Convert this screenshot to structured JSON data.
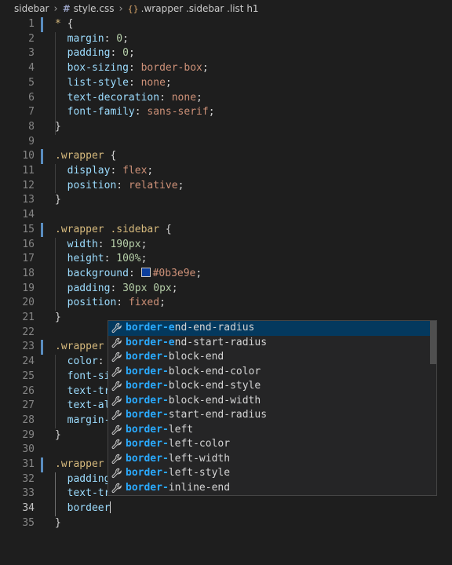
{
  "breadcrumb": {
    "folder": "sidebar",
    "file": "style.css",
    "symbol": ".wrapper .sidebar .list h1"
  },
  "editor": {
    "active_line": "34",
    "lines": [
      {
        "n": "1",
        "mod": true,
        "tokens": [
          [
            "sel",
            "* "
          ],
          [
            "punc",
            "{"
          ]
        ]
      },
      {
        "n": "2",
        "mod": false,
        "tokens": [
          [
            "punc",
            "  "
          ],
          [
            "prop",
            "margin"
          ],
          [
            "punc",
            ": "
          ],
          [
            "num",
            "0"
          ],
          [
            "punc",
            ";"
          ]
        ]
      },
      {
        "n": "3",
        "mod": false,
        "tokens": [
          [
            "punc",
            "  "
          ],
          [
            "prop",
            "padding"
          ],
          [
            "punc",
            ": "
          ],
          [
            "num",
            "0"
          ],
          [
            "punc",
            ";"
          ]
        ]
      },
      {
        "n": "4",
        "mod": false,
        "tokens": [
          [
            "punc",
            "  "
          ],
          [
            "prop",
            "box-sizing"
          ],
          [
            "punc",
            ": "
          ],
          [
            "val",
            "border-box"
          ],
          [
            "punc",
            ";"
          ]
        ]
      },
      {
        "n": "5",
        "mod": false,
        "tokens": [
          [
            "punc",
            "  "
          ],
          [
            "prop",
            "list-style"
          ],
          [
            "punc",
            ": "
          ],
          [
            "val",
            "none"
          ],
          [
            "punc",
            ";"
          ]
        ]
      },
      {
        "n": "6",
        "mod": false,
        "tokens": [
          [
            "punc",
            "  "
          ],
          [
            "prop",
            "text-decoration"
          ],
          [
            "punc",
            ": "
          ],
          [
            "val",
            "none"
          ],
          [
            "punc",
            ";"
          ]
        ]
      },
      {
        "n": "7",
        "mod": false,
        "tokens": [
          [
            "punc",
            "  "
          ],
          [
            "prop",
            "font-family"
          ],
          [
            "punc",
            ": "
          ],
          [
            "val",
            "sans-serif"
          ],
          [
            "punc",
            ";"
          ]
        ]
      },
      {
        "n": "8",
        "mod": false,
        "tokens": [
          [
            "punc",
            "}"
          ]
        ]
      },
      {
        "n": "9",
        "mod": false,
        "tokens": []
      },
      {
        "n": "10",
        "mod": true,
        "tokens": [
          [
            "sel",
            ".wrapper "
          ],
          [
            "punc",
            "{"
          ]
        ]
      },
      {
        "n": "11",
        "mod": false,
        "tokens": [
          [
            "punc",
            "  "
          ],
          [
            "prop",
            "display"
          ],
          [
            "punc",
            ": "
          ],
          [
            "val",
            "flex"
          ],
          [
            "punc",
            ";"
          ]
        ]
      },
      {
        "n": "12",
        "mod": false,
        "tokens": [
          [
            "punc",
            "  "
          ],
          [
            "prop",
            "position"
          ],
          [
            "punc",
            ": "
          ],
          [
            "val",
            "relative"
          ],
          [
            "punc",
            ";"
          ]
        ]
      },
      {
        "n": "13",
        "mod": false,
        "tokens": [
          [
            "punc",
            "}"
          ]
        ]
      },
      {
        "n": "14",
        "mod": false,
        "tokens": []
      },
      {
        "n": "15",
        "mod": true,
        "tokens": [
          [
            "sel",
            ".wrapper .sidebar "
          ],
          [
            "punc",
            "{"
          ]
        ]
      },
      {
        "n": "16",
        "mod": false,
        "tokens": [
          [
            "punc",
            "  "
          ],
          [
            "prop",
            "width"
          ],
          [
            "punc",
            ": "
          ],
          [
            "num",
            "190px"
          ],
          [
            "punc",
            ";"
          ]
        ]
      },
      {
        "n": "17",
        "mod": false,
        "tokens": [
          [
            "punc",
            "  "
          ],
          [
            "prop",
            "height"
          ],
          [
            "punc",
            ": "
          ],
          [
            "num",
            "100%"
          ],
          [
            "punc",
            ";"
          ]
        ]
      },
      {
        "n": "18",
        "mod": false,
        "tokens": [
          [
            "punc",
            "  "
          ],
          [
            "prop",
            "background"
          ],
          [
            "punc",
            ": "
          ],
          [
            "swatch",
            ""
          ],
          [
            "val",
            "#0b3e9e"
          ],
          [
            "punc",
            ";"
          ]
        ]
      },
      {
        "n": "19",
        "mod": false,
        "tokens": [
          [
            "punc",
            "  "
          ],
          [
            "prop",
            "padding"
          ],
          [
            "punc",
            ": "
          ],
          [
            "num",
            "30px 0px"
          ],
          [
            "punc",
            ";"
          ]
        ]
      },
      {
        "n": "20",
        "mod": false,
        "tokens": [
          [
            "punc",
            "  "
          ],
          [
            "prop",
            "position"
          ],
          [
            "punc",
            ": "
          ],
          [
            "val",
            "fixed"
          ],
          [
            "punc",
            ";"
          ]
        ]
      },
      {
        "n": "21",
        "mod": false,
        "tokens": [
          [
            "punc",
            "}"
          ]
        ]
      },
      {
        "n": "22",
        "mod": false,
        "tokens": []
      },
      {
        "n": "23",
        "mod": true,
        "tokens": [
          [
            "sel",
            ".wrapper"
          ]
        ]
      },
      {
        "n": "24",
        "mod": false,
        "tokens": [
          [
            "punc",
            "  "
          ],
          [
            "prop",
            "color"
          ],
          [
            "punc",
            ":"
          ]
        ]
      },
      {
        "n": "25",
        "mod": false,
        "tokens": [
          [
            "punc",
            "  "
          ],
          [
            "prop",
            "font-si"
          ]
        ]
      },
      {
        "n": "26",
        "mod": false,
        "tokens": [
          [
            "punc",
            "  "
          ],
          [
            "prop",
            "text-tr"
          ]
        ]
      },
      {
        "n": "27",
        "mod": false,
        "tokens": [
          [
            "punc",
            "  "
          ],
          [
            "prop",
            "text-al"
          ]
        ]
      },
      {
        "n": "28",
        "mod": false,
        "tokens": [
          [
            "punc",
            "  "
          ],
          [
            "prop",
            "margin-"
          ]
        ]
      },
      {
        "n": "29",
        "mod": false,
        "tokens": [
          [
            "punc",
            "}"
          ]
        ]
      },
      {
        "n": "30",
        "mod": false,
        "tokens": []
      },
      {
        "n": "31",
        "mod": true,
        "tokens": [
          [
            "sel",
            ".wrapper"
          ]
        ]
      },
      {
        "n": "32",
        "mod": false,
        "tokens": [
          [
            "punc",
            "  "
          ],
          [
            "prop",
            "padding"
          ]
        ]
      },
      {
        "n": "33",
        "mod": false,
        "tokens": [
          [
            "punc",
            "  "
          ],
          [
            "prop",
            "text-tr"
          ]
        ]
      },
      {
        "n": "34",
        "mod": false,
        "tokens": [
          [
            "punc",
            "  "
          ],
          [
            "prop",
            "bordeer"
          ],
          [
            "caret",
            ""
          ]
        ]
      },
      {
        "n": "35",
        "mod": false,
        "tokens": [
          [
            "punc",
            "}"
          ]
        ]
      }
    ]
  },
  "suggestions": {
    "selected_index": 0,
    "items": [
      {
        "match": "border-e",
        "rest": "nd-end-radius"
      },
      {
        "match": "border-e",
        "rest": "nd-start-radius"
      },
      {
        "match": "border-",
        "rest": "block-end"
      },
      {
        "match": "border-",
        "rest": "block-end-color"
      },
      {
        "match": "border-",
        "rest": "block-end-style"
      },
      {
        "match": "border-",
        "rest": "block-end-width"
      },
      {
        "match": "border-",
        "rest": "start-end-radius"
      },
      {
        "match": "border-",
        "rest": "left"
      },
      {
        "match": "border-",
        "rest": "left-color"
      },
      {
        "match": "border-",
        "rest": "left-width"
      },
      {
        "match": "border-",
        "rest": "left-style"
      },
      {
        "match": "border-",
        "rest": "inline-end"
      }
    ],
    "icon": "wrench-icon"
  },
  "colors": {
    "background": "#1e1e1e",
    "selector": "#d7ba7d",
    "property": "#9cdcfe",
    "number": "#b5cea8",
    "string_value": "#ce9178",
    "match_highlight": "#2aaaff",
    "selection": "#04395e"
  }
}
